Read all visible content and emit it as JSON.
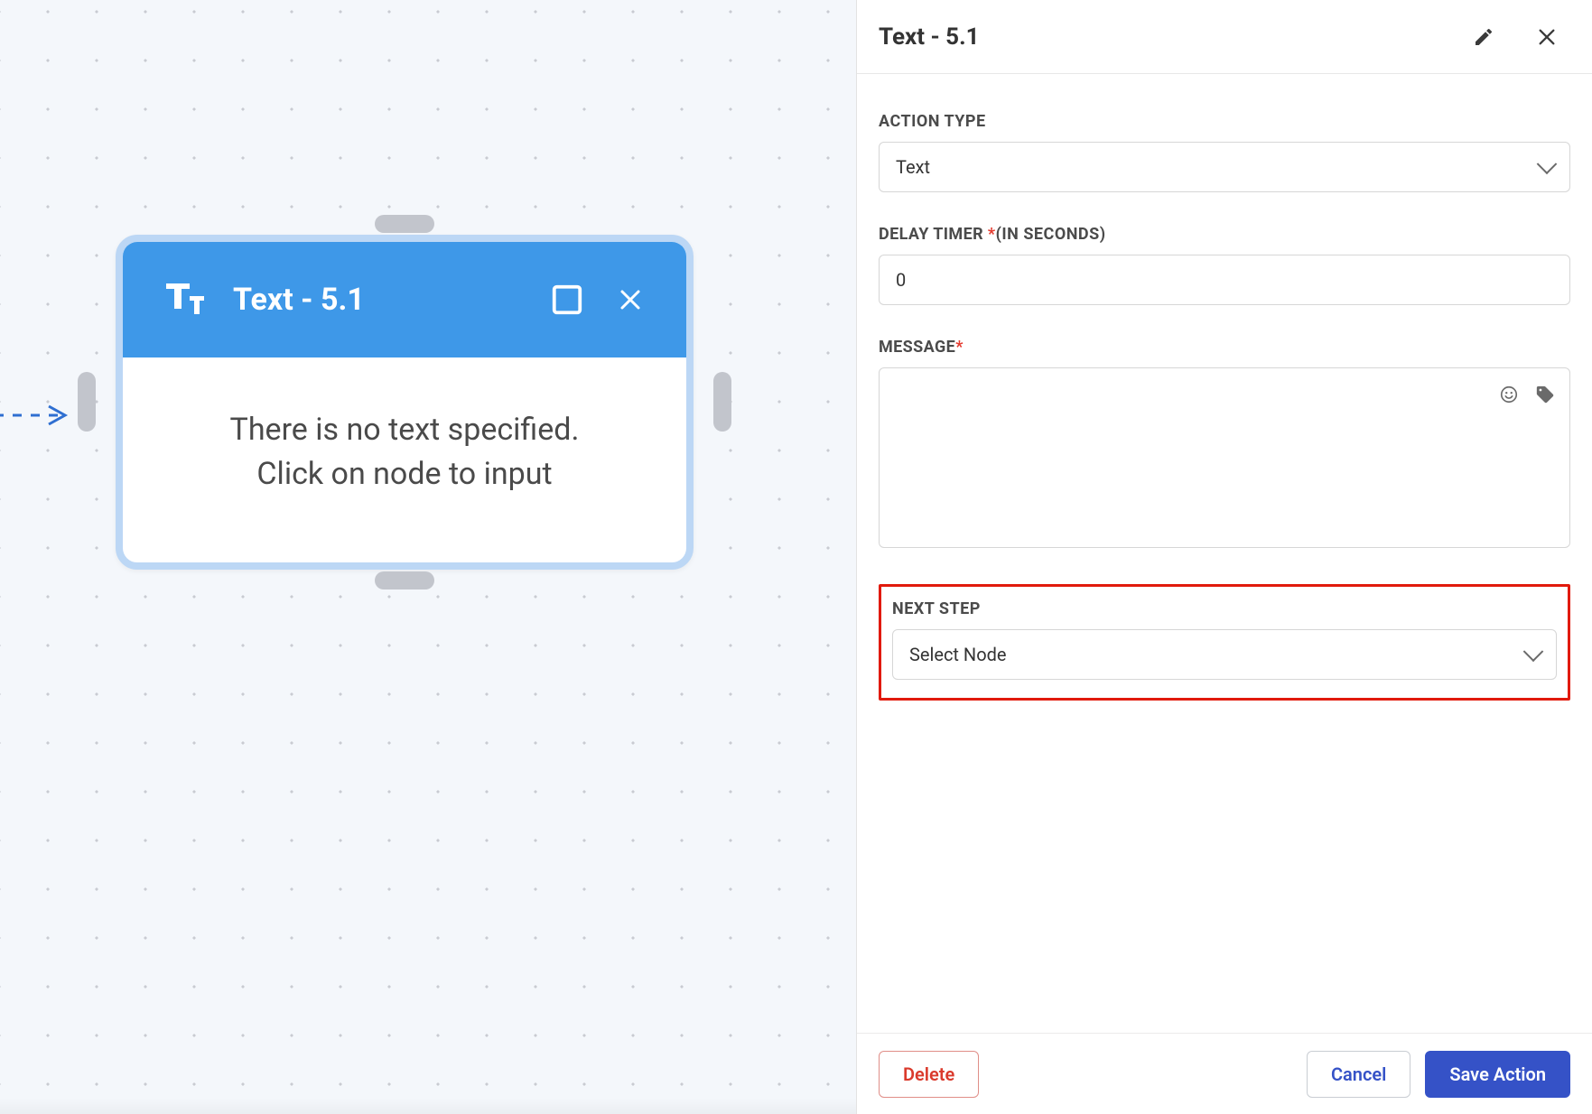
{
  "canvas": {
    "node": {
      "title": "Text - 5.1",
      "body_line1": "There is no text specified.",
      "body_line2": "Click on node to input"
    }
  },
  "panel": {
    "header": {
      "title": "Text - 5.1"
    },
    "fields": {
      "action_type": {
        "label": "ACTION TYPE",
        "selected": "Text"
      },
      "delay_timer": {
        "label_main": "DELAY TIMER ",
        "star": "*",
        "label_suffix": "(IN SECONDS)",
        "value": "0"
      },
      "message": {
        "label": "MESSAGE",
        "star": "*",
        "value": ""
      },
      "next_step": {
        "label": "NEXT STEP",
        "selected": "Select Node"
      }
    },
    "footer": {
      "delete": "Delete",
      "cancel": "Cancel",
      "save": "Save Action"
    }
  }
}
